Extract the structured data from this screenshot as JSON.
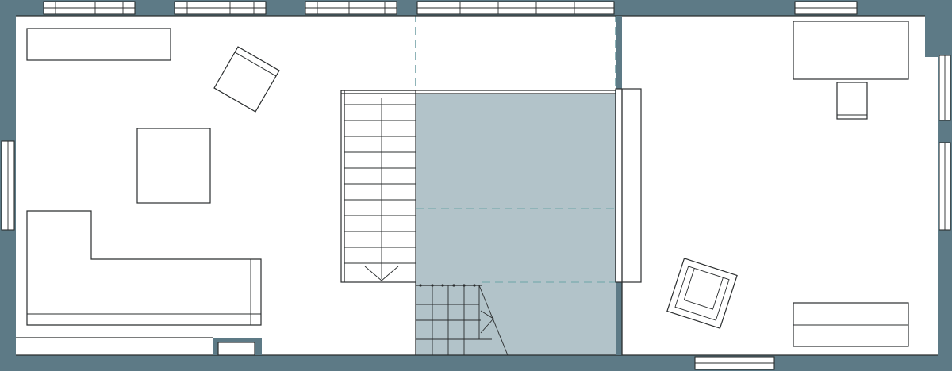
{
  "drawing": {
    "type": "architectural-floor-plan",
    "colors": {
      "wall": "#5d7a86",
      "void": "#b2c3c9",
      "dashed-line": "#8fb4b8",
      "line": "#2a2d2e",
      "background": "#ffffff"
    },
    "elements": [
      "exterior-walls",
      "interior-wall",
      "windows",
      "staircase",
      "stair-void",
      "sofa",
      "armchairs",
      "coffee-table",
      "shelf",
      "desk",
      "stool",
      "bench"
    ]
  }
}
